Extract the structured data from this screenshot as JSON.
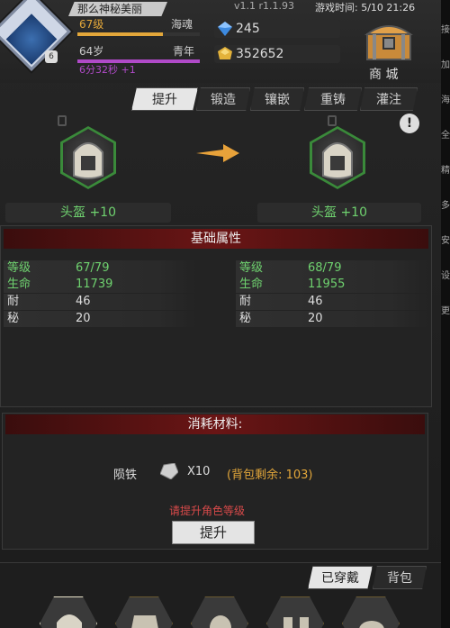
{
  "header": {
    "player_name": "那么神秘美丽",
    "level_label": "67级",
    "level_title": "海魂",
    "age_label": "64岁",
    "age_title": "青年",
    "timer": "6分32秒 +1",
    "version": "v1.1 r1.1.93",
    "game_time": "游戏时间: 5/10 21:26",
    "blue_gems": "245",
    "gold": "352652",
    "shop_label": "商 城",
    "avatar_badge": "6"
  },
  "tabs": [
    {
      "label": "提升",
      "active": true
    },
    {
      "label": "锻造",
      "active": false
    },
    {
      "label": "镶嵌",
      "active": false
    },
    {
      "label": "重铸",
      "active": false
    },
    {
      "label": "灌注",
      "active": false
    }
  ],
  "equip": {
    "left_label": "头盔 +10",
    "right_label": "头盔 +10"
  },
  "stats": {
    "title": "基础属性",
    "left": [
      {
        "key": "等级",
        "value": "67/79",
        "color": "#6fd26f"
      },
      {
        "key": "生命",
        "value": "11739",
        "color": "#6fd26f"
      },
      {
        "key": "耐",
        "value": "46",
        "color": "#dddddd"
      },
      {
        "key": "秘",
        "value": "20",
        "color": "#dddddd"
      }
    ],
    "right": [
      {
        "key": "等级",
        "value": "68/79",
        "color": "#6fd26f"
      },
      {
        "key": "生命",
        "value": "11955",
        "color": "#6fd26f"
      },
      {
        "key": "耐",
        "value": "46",
        "color": "#dddddd"
      },
      {
        "key": "秘",
        "value": "20",
        "color": "#dddddd"
      }
    ]
  },
  "consume": {
    "title": "消耗材料:",
    "material": "陨铁",
    "count": "X10",
    "remain": "(背包剩余: 103)",
    "warning": "请提升角色等级",
    "upgrade_button": "提升"
  },
  "bottom": {
    "equipped_tab": "已穿戴",
    "bag_tab": "背包"
  },
  "side_labels": [
    "接",
    "加",
    "海",
    "全",
    "精",
    "多",
    "安",
    "设",
    "更"
  ],
  "colors": {
    "green": "#6fd26f",
    "red_warning": "#d84a4a",
    "orange": "#e3a73a"
  }
}
